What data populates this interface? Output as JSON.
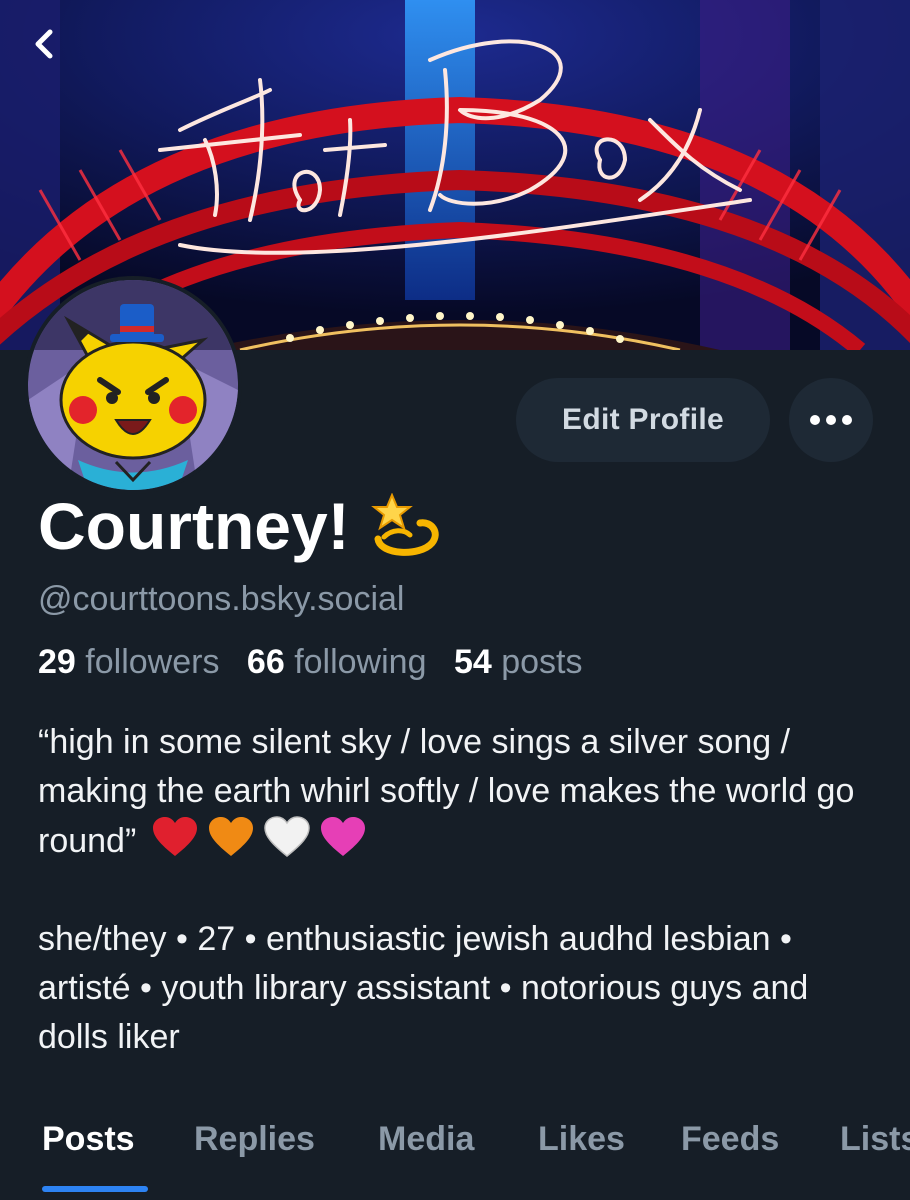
{
  "header": {
    "banner_text": "Hot Box",
    "back_icon": "chevron-left-icon"
  },
  "profile": {
    "display_name": "Courtney!",
    "name_emoji": "dizzy-star-emoji",
    "handle": "@courttoons.bsky.social",
    "edit_button_label": "Edit Profile",
    "more_icon": "ellipsis-icon"
  },
  "stats": {
    "followers_count": "29",
    "followers_label": "followers",
    "following_count": "66",
    "following_label": "following",
    "posts_count": "54",
    "posts_label": "posts"
  },
  "bio": {
    "quote": "“high in some silent sky / love sings a silver song / making the earth whirl softly / love makes the world go round”",
    "hearts": [
      "#e0202e",
      "#f08a14",
      "#f2f2f2",
      "#e63fb6"
    ],
    "details": "she/they • 27 • enthusiastic jewish audhd lesbian • artisté • youth library assistant • notorious guys and dolls liker"
  },
  "tabs": [
    {
      "label": "Posts",
      "active": true
    },
    {
      "label": "Replies",
      "active": false
    },
    {
      "label": "Media",
      "active": false
    },
    {
      "label": "Likes",
      "active": false
    },
    {
      "label": "Feeds",
      "active": false
    },
    {
      "label": "Lists",
      "active": false
    }
  ],
  "colors": {
    "background": "#161e27",
    "button_bg": "#1e2935",
    "muted_text": "#8b99a7",
    "accent": "#2d83f3"
  }
}
